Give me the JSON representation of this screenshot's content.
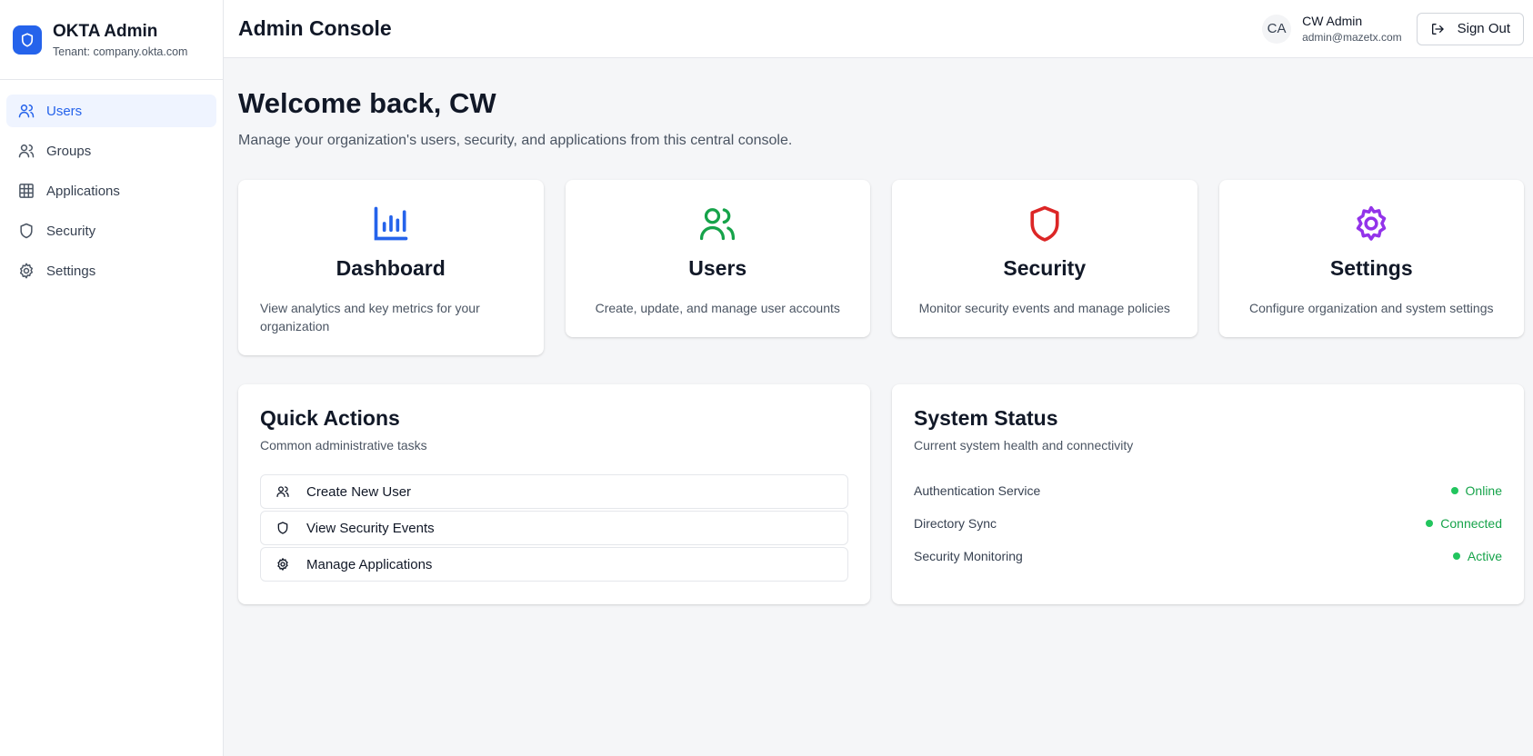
{
  "brand": {
    "title": "OKTA Admin",
    "tenant": "Tenant: company.okta.com"
  },
  "sidebar": {
    "items": [
      {
        "label": "Users",
        "icon": "users-icon",
        "active": true
      },
      {
        "label": "Groups",
        "icon": "group-icon"
      },
      {
        "label": "Applications",
        "icon": "grid-icon"
      },
      {
        "label": "Security",
        "icon": "shield-icon"
      },
      {
        "label": "Settings",
        "icon": "gear-icon"
      }
    ]
  },
  "header": {
    "title": "Admin Console",
    "user": {
      "initials": "CA",
      "name": "CW Admin",
      "email": "admin@mazetx.com"
    },
    "signout_label": "Sign Out"
  },
  "welcome": {
    "title": "Welcome back, CW",
    "subtitle": "Manage your organization's users, security, and applications from this central console."
  },
  "cards": [
    {
      "title": "Dashboard",
      "desc": "View analytics and key metrics for your organization",
      "icon": "bar-chart-icon",
      "color": "#2563eb"
    },
    {
      "title": "Users",
      "desc": "Create, update, and manage user accounts",
      "icon": "users-icon",
      "color": "#16a34a"
    },
    {
      "title": "Security",
      "desc": "Monitor security events and manage policies",
      "icon": "shield-icon",
      "color": "#dc2626"
    },
    {
      "title": "Settings",
      "desc": "Configure organization and system settings",
      "icon": "gear-icon",
      "color": "#9333ea"
    }
  ],
  "quick_actions": {
    "title": "Quick Actions",
    "subtitle": "Common administrative tasks",
    "items": [
      {
        "label": "Create New User",
        "icon": "users-icon"
      },
      {
        "label": "View Security Events",
        "icon": "shield-icon"
      },
      {
        "label": "Manage Applications",
        "icon": "gear-icon"
      }
    ]
  },
  "system_status": {
    "title": "System Status",
    "subtitle": "Current system health and connectivity",
    "items": [
      {
        "label": "Authentication Service",
        "status": "Online"
      },
      {
        "label": "Directory Sync",
        "status": "Connected"
      },
      {
        "label": "Security Monitoring",
        "status": "Active"
      }
    ],
    "status_color": "#16a34a"
  }
}
